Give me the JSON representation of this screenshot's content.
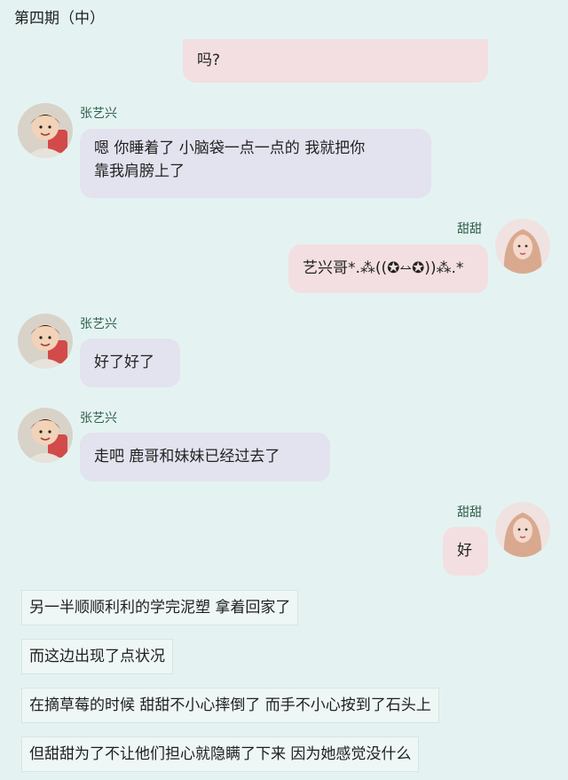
{
  "page_title": "第四期（中）",
  "messages": [
    {
      "speaker": "",
      "text": "吗?"
    },
    {
      "speaker": "张艺兴",
      "text_line1": "嗯 你睡着了 小脑袋一点一点的 我就把你",
      "text_line2": "靠我肩膀上了"
    },
    {
      "speaker": "甜甜",
      "text": "艺兴哥*.⁂((✪⥎✪))⁂.*"
    },
    {
      "speaker": "张艺兴",
      "text": "好了好了"
    },
    {
      "speaker": "张艺兴",
      "text": "走吧 鹿哥和妹妹已经过去了"
    },
    {
      "speaker": "甜甜",
      "text": "好"
    }
  ],
  "narration": [
    "另一半顺顺利利的学完泥塑 拿着回家了",
    "而这边出现了点状况",
    "在摘草莓的时候 甜甜不小心摔倒了 而手不小心按到了石头上",
    "但甜甜为了不让他们担心就隐瞒了下来 因为她感觉没什么"
  ],
  "colors": {
    "background": "#e4f3f1",
    "left_bubble": "#e2e3ef",
    "right_bubble": "#f3dfe1",
    "name_text": "#2f5f4c"
  },
  "icons": {
    "boy_avatar": "boy-avatar-icon",
    "girl_avatar": "girl-avatar-icon"
  }
}
